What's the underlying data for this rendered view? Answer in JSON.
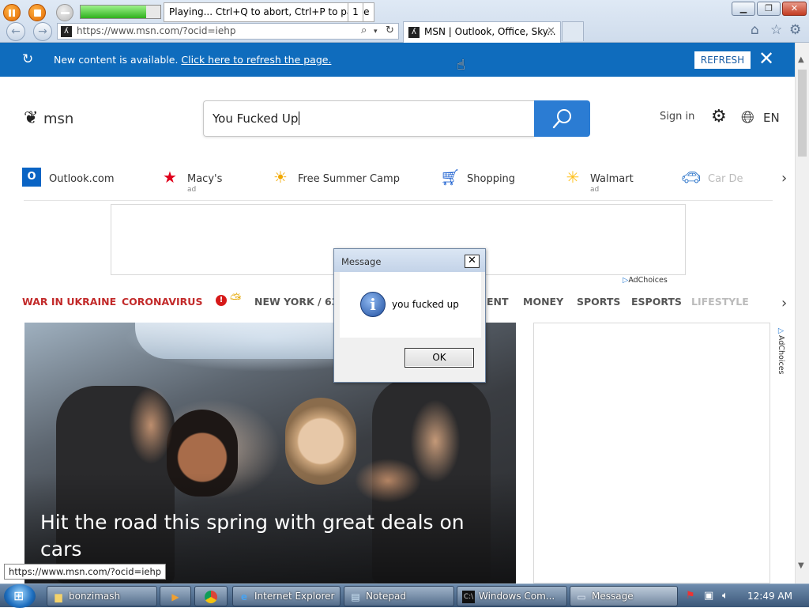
{
  "recorder": {
    "status": "Playing... Ctrl+Q to abort, Ctrl+P to pause",
    "count": "1",
    "progress": 0.82
  },
  "browser": {
    "address": "https://www.msn.com/?ocid=iehp",
    "tab_title": "MSN | Outlook, Office, Sky...",
    "tab_close": "✕",
    "status_url": "https://www.msn.com/?ocid=iehp"
  },
  "notice": {
    "text": "New content is available.",
    "link": "Click here to refresh the page.",
    "refresh_button": "REFRESH",
    "close": "✕"
  },
  "header": {
    "logo": "msn",
    "search_value": "You Fucked Up",
    "signin": "Sign in",
    "language": "EN"
  },
  "quick_links": [
    {
      "label": "Outlook.com",
      "ad": "",
      "icon": "outlook-icon"
    },
    {
      "label": "Macy's",
      "ad": "ad",
      "icon": "macys-star-icon"
    },
    {
      "label": "Free Summer Camp",
      "ad": "",
      "icon": "sun-icon"
    },
    {
      "label": "Shopping",
      "ad": "",
      "icon": "shopping-cart-icon"
    },
    {
      "label": "Walmart",
      "ad": "ad",
      "icon": "walmart-spark-icon"
    },
    {
      "label": "Car De...",
      "ad": "",
      "icon": "car-icon"
    }
  ],
  "adchoices": "AdChoices",
  "categories": [
    {
      "label": "WAR IN UKRAINE",
      "color": "#c22a2a"
    },
    {
      "label": "CORONAVIRUS",
      "color": "#c22a2a"
    },
    {
      "label": "NEW YORK / 63°",
      "color": "#555555"
    },
    {
      "label": "ENT",
      "color": "#555555"
    },
    {
      "label": "MONEY",
      "color": "#555555"
    },
    {
      "label": "SPORTS",
      "color": "#555555"
    },
    {
      "label": "ESPORTS",
      "color": "#555555"
    },
    {
      "label": "LIFESTYLE",
      "color": "#555555"
    }
  ],
  "hero": {
    "title": "Hit the road this spring with great deals on cars"
  },
  "dialog": {
    "title": "Message",
    "message": "you fucked up",
    "ok": "OK",
    "close": "✕",
    "icon": "info-icon"
  },
  "taskbar": {
    "tasks": [
      {
        "label": "bonzimash",
        "icon": "folder-icon"
      },
      {
        "label": "",
        "icon": "media-player-icon"
      },
      {
        "label": "",
        "icon": "chrome-icon"
      },
      {
        "label": "Internet Explorer",
        "icon": "ie-icon"
      },
      {
        "label": "Notepad",
        "icon": "notepad-icon"
      },
      {
        "label": "Windows Com...",
        "icon": "cmd-icon"
      },
      {
        "label": "Message",
        "icon": "window-icon"
      }
    ],
    "clock": "12:49 AM"
  },
  "colors": {
    "notice_bar": "#0f6cbd",
    "search_button": "#2b7cd3",
    "accent_red": "#c22a2a"
  }
}
